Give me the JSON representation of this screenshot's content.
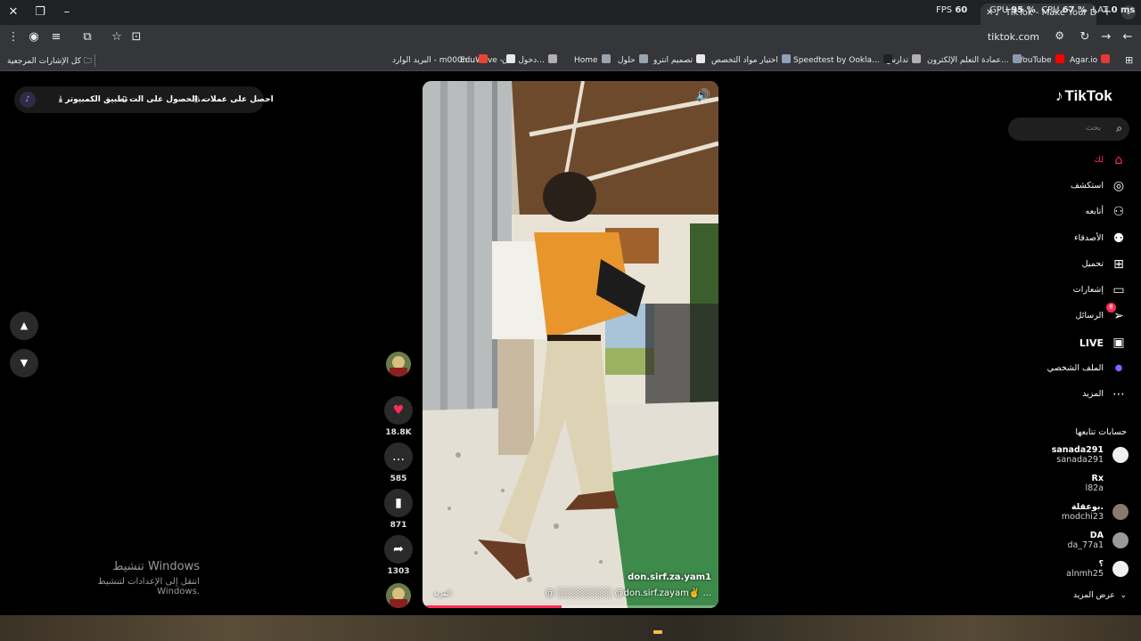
{
  "browser": {
    "perf": {
      "fps_label": "FPS",
      "fps": "60",
      "gpu_label": "GPU",
      "gpu": "95 %",
      "cpu_label": "CPU",
      "cpu": "67 %",
      "lat_label": "LAT",
      "lat": "0 ms"
    },
    "tab_title": "TikTok - Make Your Day",
    "url": "tiktok.com",
    "bookmarks_all": "كل الإشارات المرجعية",
    "bookmarks": [
      {
        "label": "Agar.io",
        "color": "#e53935"
      },
      {
        "label": "YouTube",
        "color": "#ff0000"
      },
      {
        "label": "عمادة التعلم الإلكترون...",
        "color": "#8a9bb0"
      },
      {
        "label": "تدارس",
        "color": "#b0b0b0"
      },
      {
        "label": "Speedtest by Ookla...",
        "color": "#202124"
      },
      {
        "label": "اختيار مواد التخصص",
        "color": "#8fa0b8"
      },
      {
        "label": "تصميم انترو",
        "color": "#e8e8e8"
      },
      {
        "label": "حلول",
        "color": "#9aa4b0"
      },
      {
        "label": "Home",
        "color": "#9aa4b0"
      },
      {
        "label": "دخول :: ن...",
        "color": "#b0b0b0"
      },
      {
        "label": "EduWave -",
        "color": "#e8e8e8"
      },
      {
        "label": "البريد الوارد - m000n...",
        "color": "#ea4335"
      }
    ]
  },
  "promo": {
    "coins": "احصل على عملات",
    "app": "الحصول على الت...",
    "desktop": "تطبيق الكمبيوتر"
  },
  "video": {
    "username": "don.sirf.za.yam1",
    "caption": "@ ░░░░░░░░ @don.sirf.zayam✌️ ...",
    "more": "المزيد",
    "progress": 0.47
  },
  "actions": {
    "likes": "18.8K",
    "comments": "585",
    "saves": "871",
    "shares": "1303"
  },
  "sidebar": {
    "logo": "TikTok",
    "search_placeholder": "بحث",
    "nav": [
      {
        "label": "لك",
        "icon": "⌂",
        "name": "for-you",
        "active": true
      },
      {
        "label": "استكشف",
        "icon": "◎",
        "name": "explore"
      },
      {
        "label": "أتابعه",
        "icon": "⚇",
        "name": "following"
      },
      {
        "label": "الأصدقاء",
        "icon": "⚉",
        "name": "friends"
      },
      {
        "label": "تحميل",
        "icon": "⊞",
        "name": "upload"
      },
      {
        "label": "إشعارات",
        "icon": "▭",
        "name": "activity"
      },
      {
        "label": "الرسائل",
        "icon": "➢",
        "name": "messages",
        "badge": "8"
      },
      {
        "label": "LIVE",
        "icon": "▣",
        "name": "live"
      },
      {
        "label": "الملف الشخصي",
        "icon": "●",
        "name": "profile"
      },
      {
        "label": "المزيد",
        "icon": "⋯",
        "name": "more"
      }
    ],
    "following_title": "حسابات تتابعها",
    "accounts": [
      {
        "name": "sanada291",
        "handle": "sanada291"
      },
      {
        "name": "Rx",
        "handle": "l82a"
      },
      {
        "name": "بوعقلة.",
        "handle": "modchi23"
      },
      {
        "name": "DA",
        "handle": "da_77a1"
      },
      {
        "name": "؟",
        "handle": "alnmh25"
      }
    ],
    "see_more": "عرض المزيد"
  },
  "watermark": {
    "title": "تنشيط Windows",
    "subtitle": "انتقل إلى الإعدادات لتنشيط Windows."
  }
}
